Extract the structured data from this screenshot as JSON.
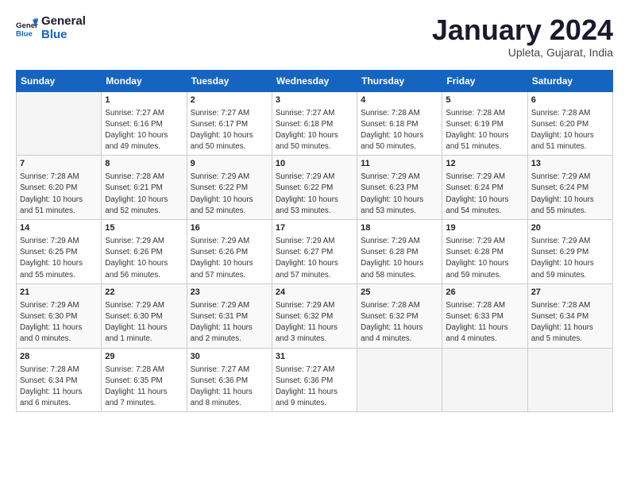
{
  "logo": {
    "line1": "General",
    "line2": "Blue"
  },
  "title": "January 2024",
  "subtitle": "Upleta, Gujarat, India",
  "days_header": [
    "Sunday",
    "Monday",
    "Tuesday",
    "Wednesday",
    "Thursday",
    "Friday",
    "Saturday"
  ],
  "weeks": [
    [
      {
        "num": "",
        "info": ""
      },
      {
        "num": "1",
        "info": "Sunrise: 7:27 AM\nSunset: 6:16 PM\nDaylight: 10 hours\nand 49 minutes."
      },
      {
        "num": "2",
        "info": "Sunrise: 7:27 AM\nSunset: 6:17 PM\nDaylight: 10 hours\nand 50 minutes."
      },
      {
        "num": "3",
        "info": "Sunrise: 7:27 AM\nSunset: 6:18 PM\nDaylight: 10 hours\nand 50 minutes."
      },
      {
        "num": "4",
        "info": "Sunrise: 7:28 AM\nSunset: 6:18 PM\nDaylight: 10 hours\nand 50 minutes."
      },
      {
        "num": "5",
        "info": "Sunrise: 7:28 AM\nSunset: 6:19 PM\nDaylight: 10 hours\nand 51 minutes."
      },
      {
        "num": "6",
        "info": "Sunrise: 7:28 AM\nSunset: 6:20 PM\nDaylight: 10 hours\nand 51 minutes."
      }
    ],
    [
      {
        "num": "7",
        "info": "Sunrise: 7:28 AM\nSunset: 6:20 PM\nDaylight: 10 hours\nand 51 minutes."
      },
      {
        "num": "8",
        "info": "Sunrise: 7:28 AM\nSunset: 6:21 PM\nDaylight: 10 hours\nand 52 minutes."
      },
      {
        "num": "9",
        "info": "Sunrise: 7:29 AM\nSunset: 6:22 PM\nDaylight: 10 hours\nand 52 minutes."
      },
      {
        "num": "10",
        "info": "Sunrise: 7:29 AM\nSunset: 6:22 PM\nDaylight: 10 hours\nand 53 minutes."
      },
      {
        "num": "11",
        "info": "Sunrise: 7:29 AM\nSunset: 6:23 PM\nDaylight: 10 hours\nand 53 minutes."
      },
      {
        "num": "12",
        "info": "Sunrise: 7:29 AM\nSunset: 6:24 PM\nDaylight: 10 hours\nand 54 minutes."
      },
      {
        "num": "13",
        "info": "Sunrise: 7:29 AM\nSunset: 6:24 PM\nDaylight: 10 hours\nand 55 minutes."
      }
    ],
    [
      {
        "num": "14",
        "info": "Sunrise: 7:29 AM\nSunset: 6:25 PM\nDaylight: 10 hours\nand 55 minutes."
      },
      {
        "num": "15",
        "info": "Sunrise: 7:29 AM\nSunset: 6:26 PM\nDaylight: 10 hours\nand 56 minutes."
      },
      {
        "num": "16",
        "info": "Sunrise: 7:29 AM\nSunset: 6:26 PM\nDaylight: 10 hours\nand 57 minutes."
      },
      {
        "num": "17",
        "info": "Sunrise: 7:29 AM\nSunset: 6:27 PM\nDaylight: 10 hours\nand 57 minutes."
      },
      {
        "num": "18",
        "info": "Sunrise: 7:29 AM\nSunset: 6:28 PM\nDaylight: 10 hours\nand 58 minutes."
      },
      {
        "num": "19",
        "info": "Sunrise: 7:29 AM\nSunset: 6:28 PM\nDaylight: 10 hours\nand 59 minutes."
      },
      {
        "num": "20",
        "info": "Sunrise: 7:29 AM\nSunset: 6:29 PM\nDaylight: 10 hours\nand 59 minutes."
      }
    ],
    [
      {
        "num": "21",
        "info": "Sunrise: 7:29 AM\nSunset: 6:30 PM\nDaylight: 11 hours\nand 0 minutes."
      },
      {
        "num": "22",
        "info": "Sunrise: 7:29 AM\nSunset: 6:30 PM\nDaylight: 11 hours\nand 1 minute."
      },
      {
        "num": "23",
        "info": "Sunrise: 7:29 AM\nSunset: 6:31 PM\nDaylight: 11 hours\nand 2 minutes."
      },
      {
        "num": "24",
        "info": "Sunrise: 7:29 AM\nSunset: 6:32 PM\nDaylight: 11 hours\nand 3 minutes."
      },
      {
        "num": "25",
        "info": "Sunrise: 7:28 AM\nSunset: 6:32 PM\nDaylight: 11 hours\nand 4 minutes."
      },
      {
        "num": "26",
        "info": "Sunrise: 7:28 AM\nSunset: 6:33 PM\nDaylight: 11 hours\nand 4 minutes."
      },
      {
        "num": "27",
        "info": "Sunrise: 7:28 AM\nSunset: 6:34 PM\nDaylight: 11 hours\nand 5 minutes."
      }
    ],
    [
      {
        "num": "28",
        "info": "Sunrise: 7:28 AM\nSunset: 6:34 PM\nDaylight: 11 hours\nand 6 minutes."
      },
      {
        "num": "29",
        "info": "Sunrise: 7:28 AM\nSunset: 6:35 PM\nDaylight: 11 hours\nand 7 minutes."
      },
      {
        "num": "30",
        "info": "Sunrise: 7:27 AM\nSunset: 6:36 PM\nDaylight: 11 hours\nand 8 minutes."
      },
      {
        "num": "31",
        "info": "Sunrise: 7:27 AM\nSunset: 6:36 PM\nDaylight: 11 hours\nand 9 minutes."
      },
      {
        "num": "",
        "info": ""
      },
      {
        "num": "",
        "info": ""
      },
      {
        "num": "",
        "info": ""
      }
    ]
  ]
}
